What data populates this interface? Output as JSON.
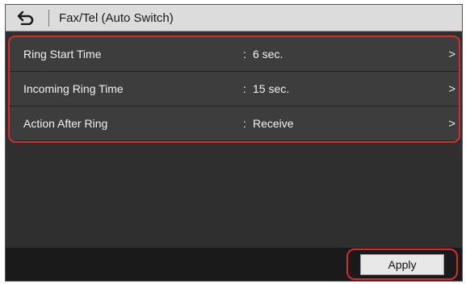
{
  "header": {
    "title": "Fax/Tel (Auto Switch)",
    "back_icon": "back-arrow-icon"
  },
  "settings": [
    {
      "label": "Ring Start Time",
      "separator": ":",
      "value": "6 sec.",
      "chevron": ">"
    },
    {
      "label": "Incoming Ring Time",
      "separator": ":",
      "value": "15 sec.",
      "chevron": ">"
    },
    {
      "label": "Action After Ring",
      "separator": ":",
      "value": "Receive",
      "chevron": ">"
    }
  ],
  "footer": {
    "apply_label": "Apply"
  },
  "colors": {
    "highlight": "#d42c2c",
    "screen_bg": "#2f2f2f",
    "row_bg": "#3d3d3d",
    "title_bg": "#dcdcdc"
  }
}
